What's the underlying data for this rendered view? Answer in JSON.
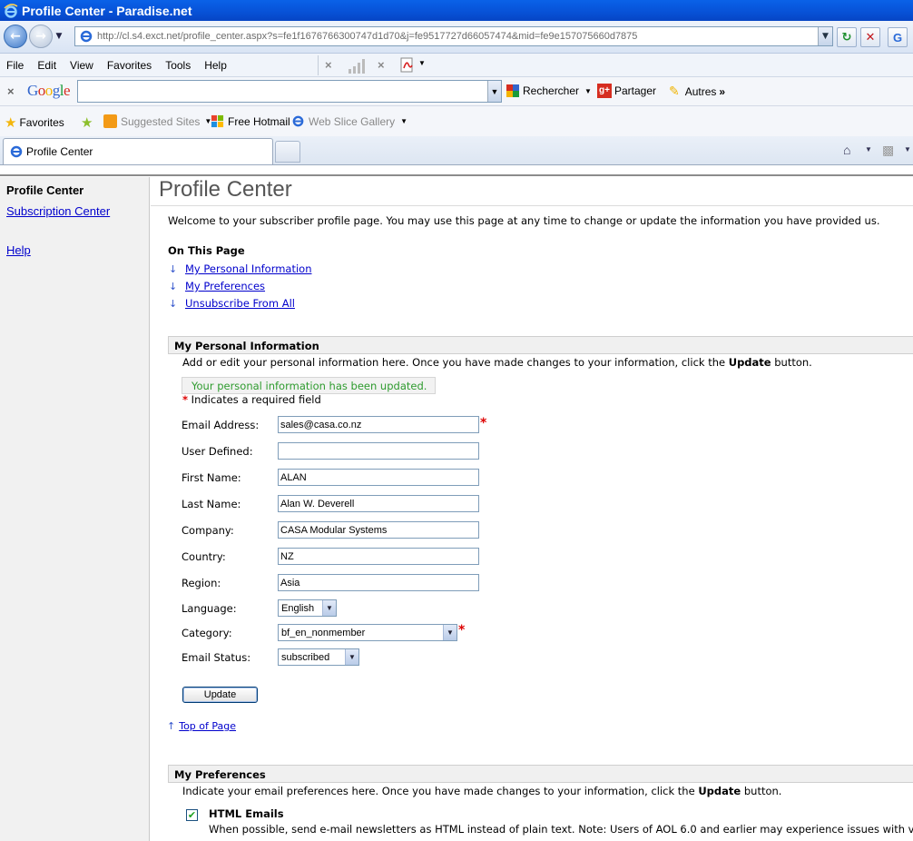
{
  "browser": {
    "window_title": "Profile Center - Paradise.net",
    "url": "http://cl.s4.exct.net/profile_center.aspx?s=fe1f1676766300747d1d70&j=fe9517727d66057474&mid=fe9e157075660d7875",
    "menu": [
      "File",
      "Edit",
      "View",
      "Favorites",
      "Tools",
      "Help"
    ],
    "google": {
      "logo": "Google",
      "search_value": "",
      "rechercher": "Rechercher",
      "partager": "Partager",
      "autres": "Autres"
    },
    "favorites": {
      "favorites_label": "Favorites",
      "suggested_sites": "Suggested Sites",
      "free_hotmail": "Free Hotmail",
      "web_slice_gallery": "Web Slice Gallery"
    },
    "tab_title": "Profile Center"
  },
  "sidebar": {
    "title": "Profile Center",
    "links": [
      "Subscription Center",
      "Help"
    ]
  },
  "page": {
    "title": "Profile Center",
    "welcome": "Welcome to your subscriber profile page. You may use this page at any time to change or update the information you have provided us.",
    "on_this_page": "On This Page",
    "toc": [
      "My Personal Information",
      "My Preferences",
      "Unsubscribe From All"
    ],
    "personal": {
      "heading": "My Personal Information",
      "desc_pre": "Add or edit your personal information here. Once you have made changes to your information, click the ",
      "desc_bold": "Update",
      "desc_post": " button.",
      "updated_msg": "Your personal information has been updated.",
      "required_star": "*",
      "required_note": " Indicates a required field",
      "fields": {
        "email": {
          "label": "Email Address:",
          "value": "sales@casa.co.nz"
        },
        "user_defined": {
          "label": "User Defined:",
          "value": ""
        },
        "first_name": {
          "label": "First Name:",
          "value": "ALAN"
        },
        "last_name": {
          "label": "Last Name:",
          "value": "Alan W. Deverell"
        },
        "company": {
          "label": "Company:",
          "value": "CASA Modular Systems"
        },
        "country": {
          "label": "Country:",
          "value": "NZ"
        },
        "region": {
          "label": "Region:",
          "value": "Asia"
        },
        "language": {
          "label": "Language:",
          "value": "English"
        },
        "category": {
          "label": "Category:",
          "value": "bf_en_nonmember"
        },
        "email_status": {
          "label": "Email Status:",
          "value": "subscribed"
        }
      },
      "update_button": "Update",
      "top_of_page": "Top of Page"
    },
    "preferences": {
      "heading": "My Preferences",
      "desc_pre": "Indicate your email preferences here. Once you have made changes to your information, click the ",
      "desc_bold": "Update",
      "desc_post": " button.",
      "html_emails_title": "HTML Emails",
      "html_emails_checked": true,
      "html_emails_desc": "When possible, send e-mail newsletters as HTML instead of plain text. Note: Users of AOL 6.0 and earlier may experience issues with vi"
    }
  },
  "colors": {
    "link": "#0000cc",
    "success": "#2e9b2e",
    "required": "#dd0000",
    "titlebar": "#0751d6"
  }
}
